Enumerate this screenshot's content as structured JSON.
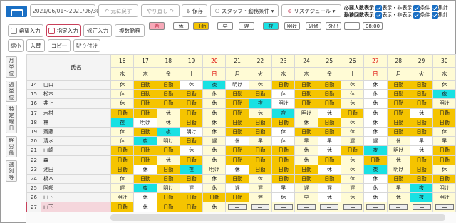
{
  "toolbar": {
    "date_range": "2021/06/01～2021/06/30",
    "undo": "元に戻す",
    "redo": "やり直し",
    "save": "保存",
    "staff_filter": "スタッフ・勤務条件",
    "reschedule": "リスケジュール",
    "required_label": "必要人数表示",
    "workcount_label": "勤務回数表示",
    "opt_show": "表示・非表示",
    "opt_cond": "条件",
    "opt_total": "集計"
  },
  "toolbar2": {
    "wish_input": "希望入力",
    "designated_input": "指定入力",
    "fix_input": "修正入力",
    "multi_shift": "複数勤務",
    "shrink": "縮小",
    "swap": "入替",
    "copy": "コピー",
    "paste": "貼り付け"
  },
  "legend": [
    "希",
    "休",
    "日勤",
    "早",
    "遅",
    "夜",
    "明け",
    "研修",
    "外出",
    "08:00"
  ],
  "side_tabs": [
    "月単位",
    "週単位",
    "特定曜日",
    "経労働",
    "選別等"
  ],
  "header": {
    "name_col": "氏名",
    "days": [
      "16",
      "17",
      "18",
      "19",
      "20",
      "21",
      "22",
      "23",
      "24",
      "25",
      "26",
      "27",
      "28",
      "29",
      "30"
    ],
    "weekdays": [
      "水",
      "木",
      "金",
      "土",
      "日",
      "月",
      "火",
      "水",
      "木",
      "金",
      "土",
      "日",
      "月",
      "火",
      "水"
    ]
  },
  "rows": [
    {
      "no": "14",
      "name": "山口",
      "cells": [
        "休",
        "日勤",
        "日勤",
        "休",
        "夜",
        "明け",
        "休",
        "日勤",
        "日勤",
        "日勤",
        "休",
        "休",
        "日勤",
        "日勤",
        "休"
      ]
    },
    {
      "no": "15",
      "name": "松本",
      "cells": [
        "休",
        "日勤",
        "日勤",
        "日勤",
        "休",
        "日勤",
        "日勤",
        "休",
        "日勤",
        "日勤",
        "休",
        "休",
        "日勤",
        "日勤",
        "夜"
      ]
    },
    {
      "no": "16",
      "name": "井上",
      "cells": [
        "休",
        "日勤",
        "日勤",
        "日勤",
        "休",
        "日勤",
        "夜",
        "明け",
        "日勤",
        "日勤",
        "休",
        "休",
        "日勤",
        "日勤",
        "明け"
      ]
    },
    {
      "no": "17",
      "name": "木村",
      "cells": [
        "日勤",
        "日勤",
        "休",
        "日勤",
        "休",
        "日勤",
        "休",
        "夜",
        "明け",
        "休",
        "日勤",
        "休",
        "日勤",
        "休",
        "日勤"
      ]
    },
    {
      "no": "18",
      "name": "林",
      "cells": [
        "夜",
        "明け",
        "休",
        "日勤",
        "休",
        "日勤",
        "日勤",
        "日勤",
        "休",
        "日勤",
        "休",
        "休",
        "日勤",
        "日勤",
        "日勤"
      ]
    },
    {
      "no": "19",
      "name": "斎藤",
      "cells": [
        "休",
        "日勤",
        "夜",
        "明け",
        "休",
        "日勤",
        "日勤",
        "休",
        "日勤",
        "日勤",
        "休",
        "休",
        "日勤",
        "日勤",
        "休"
      ]
    },
    {
      "no": "20",
      "name": "清水",
      "cells": [
        "休",
        "夜",
        "明け",
        "日勤",
        "遅",
        "休",
        "早",
        "休",
        "早",
        "早",
        "遅",
        "遅",
        "休",
        "早",
        "早"
      ]
    },
    {
      "no": "21",
      "name": "山崎",
      "cells": [
        "日勤",
        "日勤",
        "日勤",
        "休",
        "休",
        "日勤",
        "日勤",
        "日勤",
        "休",
        "休",
        "日勤",
        "夜",
        "明け",
        "休",
        "日勤"
      ]
    },
    {
      "no": "22",
      "name": "森",
      "cells": [
        "日勤",
        "日勤",
        "休",
        "日勤",
        "休",
        "日勤",
        "日勤",
        "日勤",
        "休",
        "日勤",
        "休",
        "日勤",
        "休",
        "日勤",
        "日勤"
      ]
    },
    {
      "no": "23",
      "name": "池田",
      "cells": [
        "日勤",
        "休",
        "日勤",
        "夜",
        "明け",
        "休",
        "日勤",
        "日勤",
        "日勤",
        "休",
        "休",
        "夜",
        "明け",
        "日勤",
        "休"
      ]
    },
    {
      "no": "24",
      "name": "橋本",
      "cells": [
        "休",
        "日勤",
        "日勤",
        "日勤",
        "休",
        "日勤",
        "休",
        "日勤",
        "日勤",
        "日勤",
        "休",
        "休",
        "日勤",
        "日勤",
        "日勤"
      ]
    },
    {
      "no": "25",
      "name": "阿部",
      "cells": [
        "遅",
        "夜",
        "明け",
        "遅",
        "休",
        "遅",
        "遅",
        "早",
        "遅",
        "遅",
        "遅",
        "休",
        "早",
        "夜",
        "明け"
      ]
    },
    {
      "no": "26",
      "name": "山下",
      "cells": [
        "明け",
        "休",
        "日勤",
        "日勤",
        "日勤",
        "日勤",
        "遅",
        "休",
        "早",
        "休",
        "休",
        "休",
        "休",
        "夜",
        "明け"
      ]
    },
    {
      "no": "27",
      "name": "山下",
      "cells": [
        "日勤",
        "休",
        "日勤",
        "日勤",
        "休",
        "",
        "",
        "",
        "",
        "",
        "",
        "",
        "",
        "",
        ""
      ]
    }
  ],
  "colors": {
    "yellow": "#f5c400",
    "cyan": "#19e1e3",
    "pale": "#fffbd5",
    "accent": "#1a6fc4",
    "sunday": "#dd0000",
    "selected_row": "#c8405a"
  }
}
